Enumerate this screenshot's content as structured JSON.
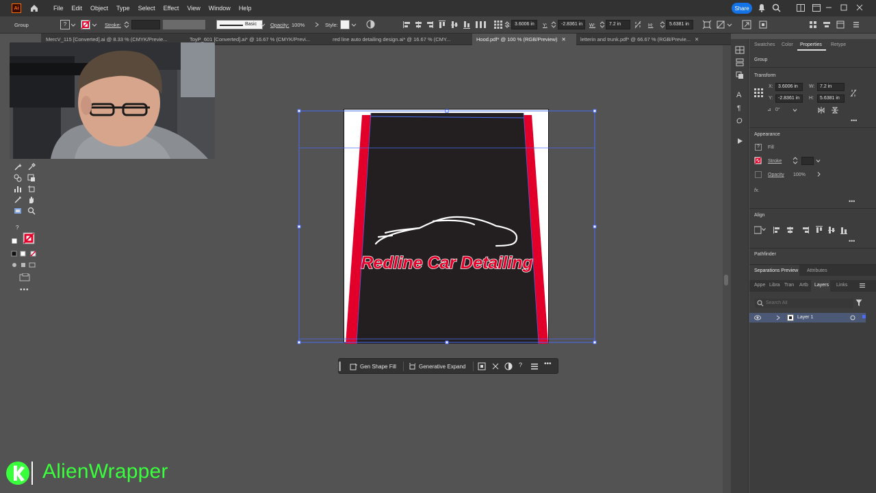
{
  "menubar": {
    "items": [
      "File",
      "Edit",
      "Object",
      "Type",
      "Select",
      "Effect",
      "View",
      "Window",
      "Help"
    ],
    "share_label": "Share"
  },
  "control_bar": {
    "selection_label": "Group",
    "stroke_label": "Stroke:",
    "brush_label": "Basic",
    "opacity_label": "Opacity:",
    "opacity_value": "100%",
    "style_label": "Style:",
    "x_label": "X:",
    "x_value": "3.6006 in",
    "y_label": "Y:",
    "y_value": "-2.8361 in",
    "w_label": "W:",
    "w_value": "7.2 in",
    "h_label": "H:",
    "h_value": "5.6381 in"
  },
  "tabs": [
    {
      "label": "MercV_115 [Converted].ai @ 8.33 % (CMYK/Previe...",
      "active": false
    },
    {
      "label": "ToyP_601 [Converted].ai* @ 16.67 % (CMYK/Previ...",
      "active": false
    },
    {
      "label": "red line auto detailing design.ai* @ 16.67 % (CMY...",
      "active": false
    },
    {
      "label": "Hood.pdf* @ 100 % (RGB/Preview)",
      "active": true
    },
    {
      "label": "letterin and trunk.pdf* @ 66.67 % (RGB/Previe...",
      "active": false
    }
  ],
  "artboard": {
    "logo_text": "Redline Car Detailing",
    "colors": {
      "dark": "#231f20",
      "red": "#e2002a",
      "white": "#ffffff",
      "selection": "#4a6cf7"
    }
  },
  "context_bar": {
    "gen_shape_fill": "Gen Shape Fill",
    "generative_expand": "Generative Expand"
  },
  "panel": {
    "tabs": [
      "Swatches",
      "Color",
      "Properties",
      "Retype"
    ],
    "active_tab": "Properties",
    "selection_label": "Group",
    "transform_title": "Transform",
    "x_label": "X:",
    "x_value": "3.6006 in",
    "y_label": "Y:",
    "y_value": "-2.8361 in",
    "w_label": "W:",
    "w_value": "7.2 in",
    "h_label": "H:",
    "h_value": "5.6381 in",
    "angle_value": "0°",
    "appearance_title": "Appearance",
    "fill_label": "Fill",
    "stroke_label": "Stroke",
    "opacity_label": "Opacity",
    "opacity_value": "100%",
    "fx_label": "fx.",
    "align_title": "Align",
    "pathfinder_title": "Pathfinder",
    "lower_tabs": [
      "Separations Preview",
      "Attributes"
    ],
    "lower_active": "Separations Preview",
    "layer_tabs": [
      "Appe",
      "Libra",
      "Tran",
      "Artb",
      "Layers",
      "Links"
    ],
    "layer_active": "Layers",
    "search_placeholder": "Search All",
    "layer_name": "Layer 1"
  },
  "branding": {
    "text": "AlienWrapper",
    "color": "#39ff3c"
  }
}
